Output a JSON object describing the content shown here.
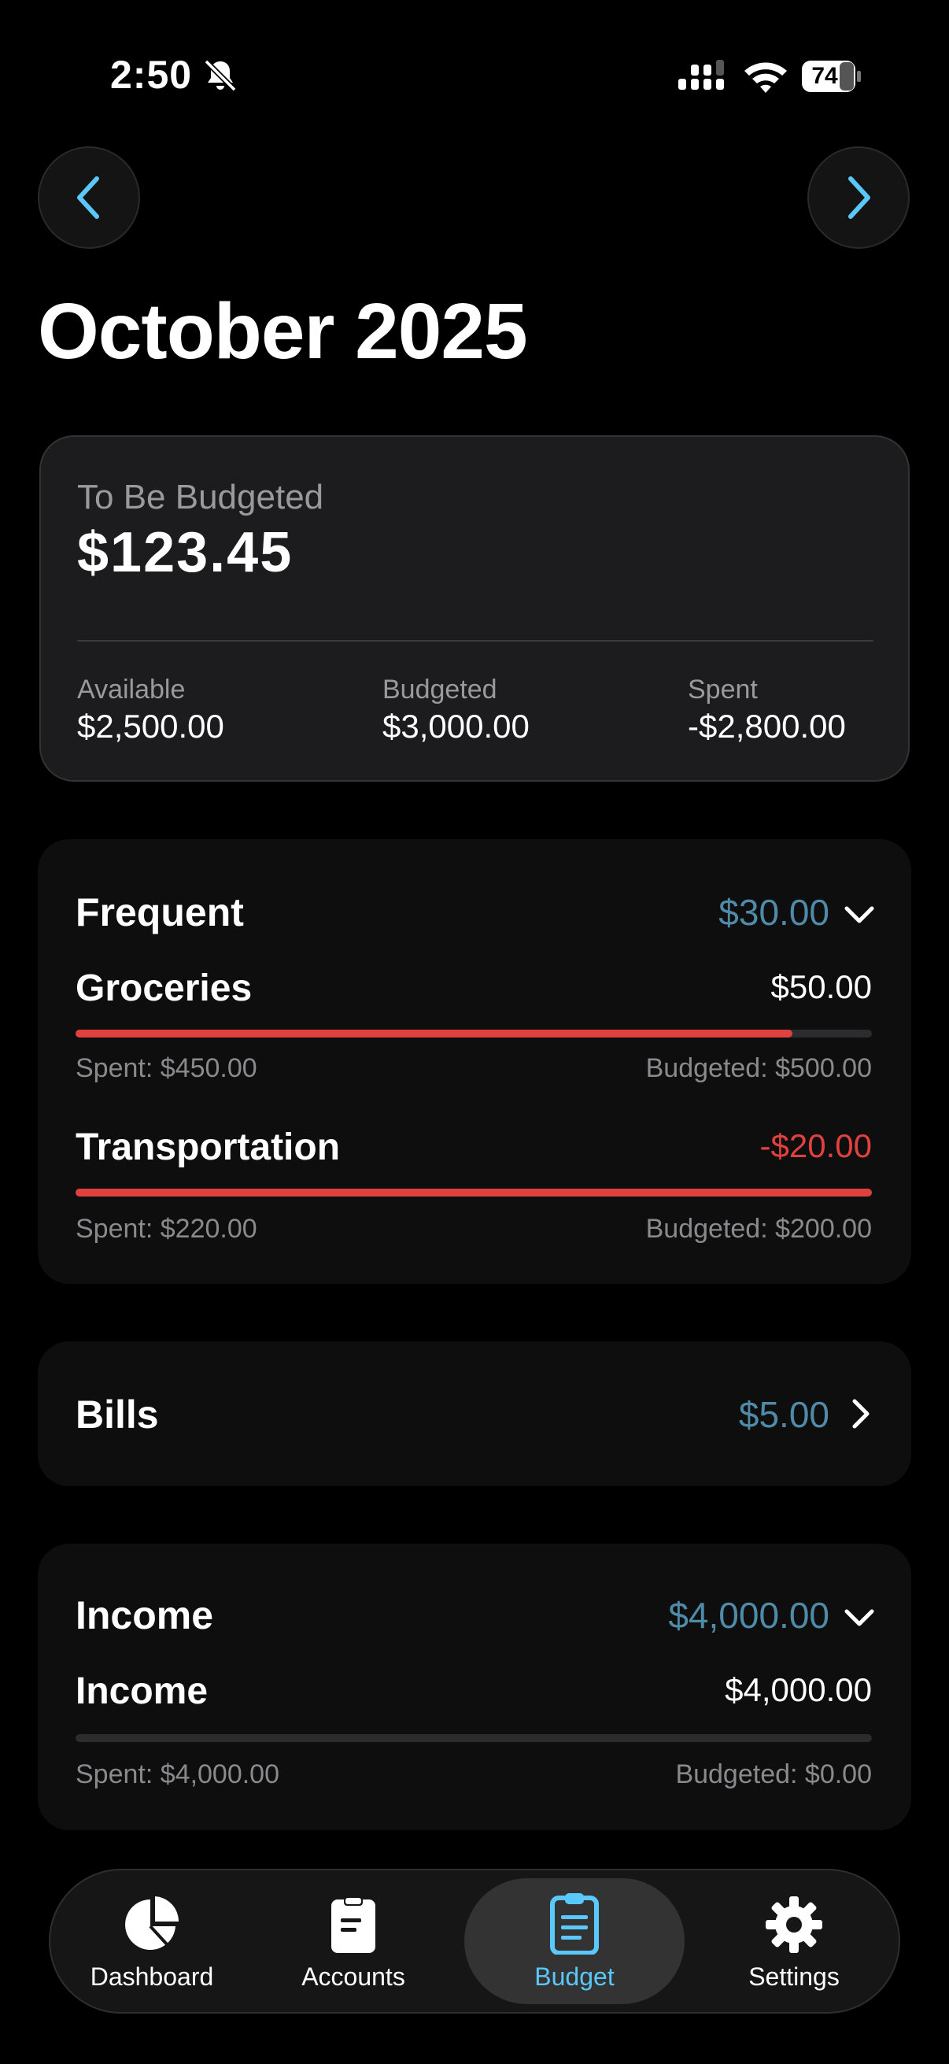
{
  "status_bar": {
    "time": "2:50",
    "battery": "74"
  },
  "header": {
    "title": "October 2025"
  },
  "summary": {
    "label": "To Be Budgeted",
    "value": "$123.45",
    "stats": [
      {
        "label": "Available",
        "value": "$2,500.00"
      },
      {
        "label": "Budgeted",
        "value": "$3,000.00"
      },
      {
        "label": "Spent",
        "value": "-$2,800.00"
      }
    ]
  },
  "groups": [
    {
      "title": "Frequent",
      "amount": "$30.00",
      "items": [
        {
          "name": "Groceries",
          "amount": "$50.00",
          "progress": 0.9,
          "spent": "Spent: $450.00",
          "budgeted": "Budgeted: $500.00"
        },
        {
          "name": "Transportation",
          "amount": "-$20.00",
          "progress": 1.0,
          "spent": "Spent: $220.00",
          "budgeted": "Budgeted: $200.00"
        }
      ]
    },
    {
      "title": "Bills",
      "amount": "$5.00",
      "items": []
    },
    {
      "title": "Income",
      "amount": "$4,000.00",
      "items": [
        {
          "name": "Income",
          "amount": "$4,000.00",
          "progress": 0,
          "spent": "Spent: $4,000.00",
          "budgeted": "Budgeted: $0.00"
        }
      ]
    }
  ],
  "tabs": [
    {
      "label": "Dashboard",
      "icon": "pie-chart-icon",
      "active": false
    },
    {
      "label": "Accounts",
      "icon": "clipboard-icon",
      "active": false
    },
    {
      "label": "Budget",
      "icon": "clipboard-list-icon",
      "active": true
    },
    {
      "label": "Settings",
      "icon": "gear-icon",
      "active": false
    }
  ],
  "colors": {
    "accent": "#5ac8fa",
    "group_amount": "#4f8aa8",
    "negative": "#e0413e",
    "background": "#000000"
  }
}
